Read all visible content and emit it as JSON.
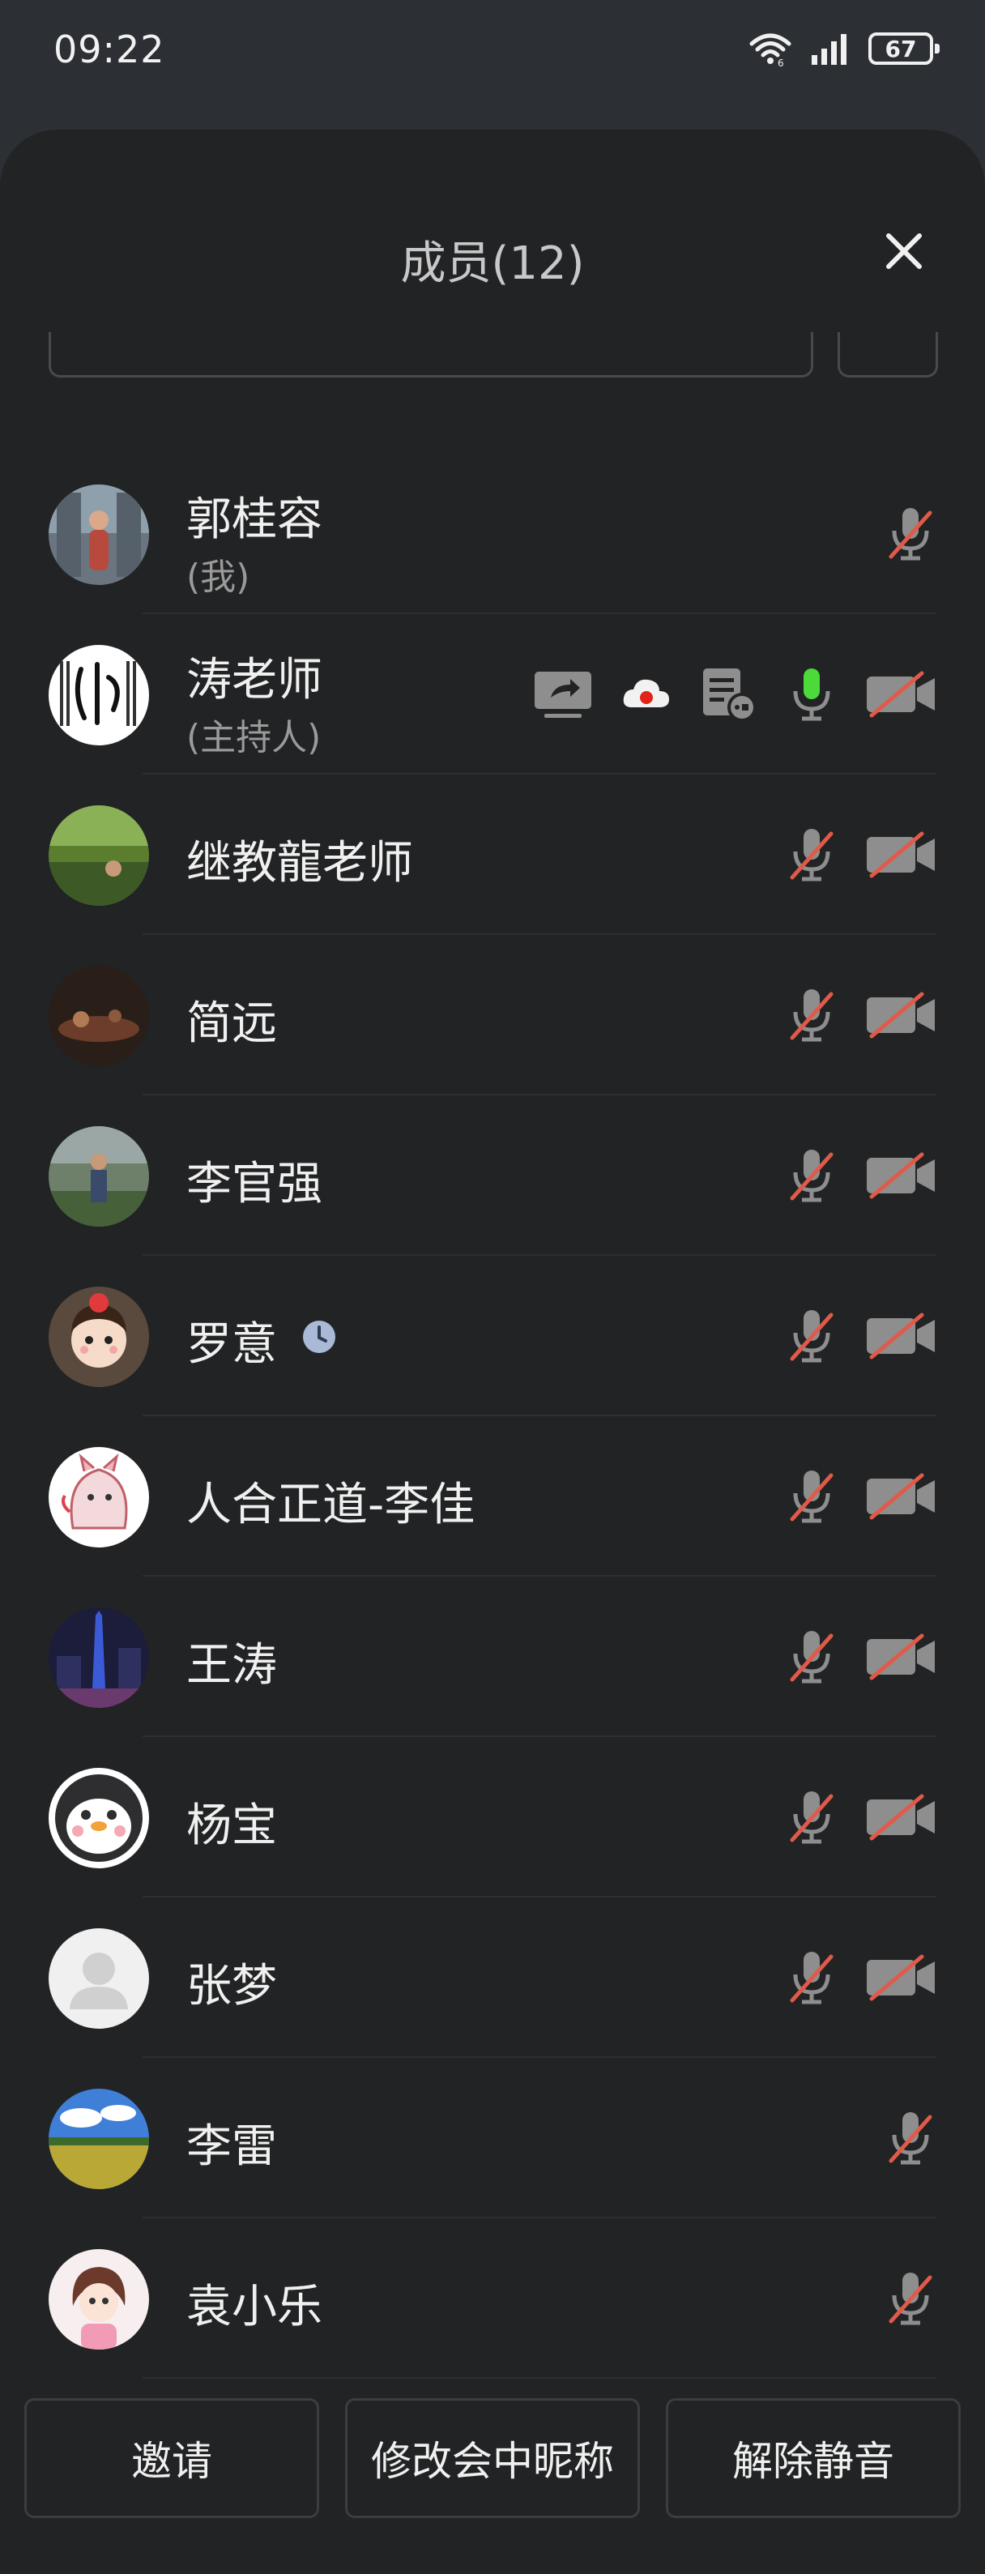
{
  "status_bar": {
    "time": "09:22",
    "battery": "67"
  },
  "panel": {
    "title": "成员(12)"
  },
  "members": [
    {
      "name": "郭桂容",
      "role": "(我)",
      "mic": "muted",
      "camera": null
    },
    {
      "name": "涛老师",
      "role": "(主持人)",
      "mic": "active",
      "camera": "off",
      "extras": [
        "screen-share-icon",
        "cloud-record-icon",
        "document-icon"
      ]
    },
    {
      "name": "继教龍老师",
      "role": "",
      "mic": "muted",
      "camera": "off"
    },
    {
      "name": "简远",
      "role": "",
      "mic": "muted",
      "camera": "off"
    },
    {
      "name": "李官强",
      "role": "",
      "mic": "muted",
      "camera": "off"
    },
    {
      "name": "罗意",
      "role": "",
      "mic": "muted",
      "camera": "off",
      "clock": true
    },
    {
      "name": "人合正道-李佳",
      "role": "",
      "mic": "muted",
      "camera": "off"
    },
    {
      "name": "王涛",
      "role": "",
      "mic": "muted",
      "camera": "off"
    },
    {
      "name": "杨宝",
      "role": "",
      "mic": "muted",
      "camera": "off"
    },
    {
      "name": "张梦",
      "role": "",
      "mic": "muted",
      "camera": "off"
    },
    {
      "name": "李雷",
      "role": "",
      "mic": "muted",
      "camera": null
    },
    {
      "name": "袁小乐",
      "role": "",
      "mic": "muted",
      "camera": null
    }
  ],
  "actions": {
    "invite": "邀请",
    "rename": "修改会中昵称",
    "unmute": "解除静音"
  },
  "colors": {
    "background": "#222324",
    "mic_active": "#4cd93a",
    "muted_slash": "#e05a4a",
    "icon_gray": "#8e8e8e"
  }
}
